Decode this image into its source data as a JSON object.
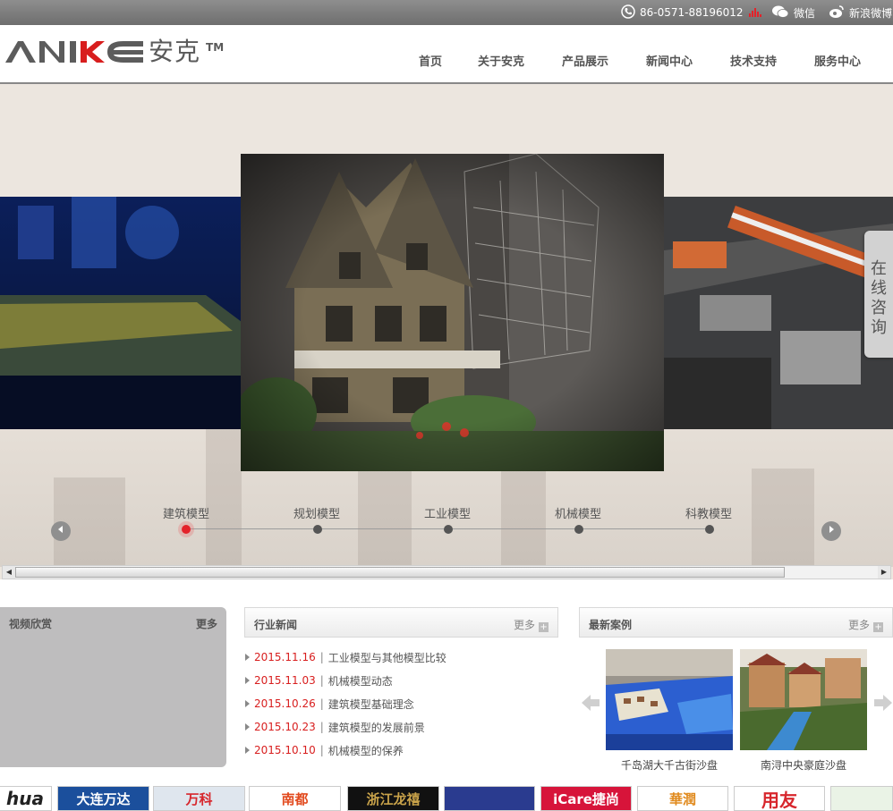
{
  "topbar": {
    "phone": "86-0571-88196012",
    "wechat": "微信",
    "weibo": "新浪微博"
  },
  "header": {
    "logo_text": "ANKE",
    "logo_cn": "安克",
    "logo_tm": "TM",
    "nav": [
      "首页",
      "关于安克",
      "产品展示",
      "新闻中心",
      "技术支持",
      "服务中心"
    ]
  },
  "slider": {
    "tabs": [
      "建筑模型",
      "规划模型",
      "工业模型",
      "机械模型",
      "科教模型"
    ],
    "active_index": 0,
    "prev_icon": "arrow-left-icon",
    "next_icon": "arrow-right-icon"
  },
  "consult": {
    "label": "在线咨询"
  },
  "video": {
    "title": "视频欣赏",
    "more": "更多"
  },
  "news": {
    "title": "行业新闻",
    "more": "更多",
    "items": [
      {
        "date": "2015.11.16",
        "text": "工业模型与其他模型比较"
      },
      {
        "date": "2015.11.03",
        "text": "机械模型动态"
      },
      {
        "date": "2015.10.26",
        "text": "建筑模型基础理念"
      },
      {
        "date": "2015.10.23",
        "text": "建筑模型的发展前景"
      },
      {
        "date": "2015.10.10",
        "text": "机械模型的保养"
      }
    ]
  },
  "cases": {
    "title": "最新案例",
    "more": "更多",
    "items": [
      {
        "caption": "千岛湖大千古街沙盘"
      },
      {
        "caption": "南浔中央豪庭沙盘"
      }
    ]
  },
  "partners": [
    {
      "label": "hua",
      "color": "#222222"
    },
    {
      "label": "大连万达",
      "color": "#1b4f9c"
    },
    {
      "label": "万科",
      "color": "#d7262c"
    },
    {
      "label": "南都",
      "color": "#e24a1e"
    },
    {
      "label": "浙江龙禧",
      "color": "#c8a24a"
    },
    {
      "label": "",
      "color": "#2a3b8f"
    },
    {
      "label": "iCare捷尚",
      "color": "#d7143a"
    },
    {
      "label": "華潤",
      "color": "#e08a1e"
    },
    {
      "label": "用友",
      "color": "#d7262c"
    },
    {
      "label": "",
      "color": "#2e8b3e"
    }
  ],
  "colors": {
    "accent_red": "#d81e1e",
    "topbar": "#7d7d7d"
  }
}
